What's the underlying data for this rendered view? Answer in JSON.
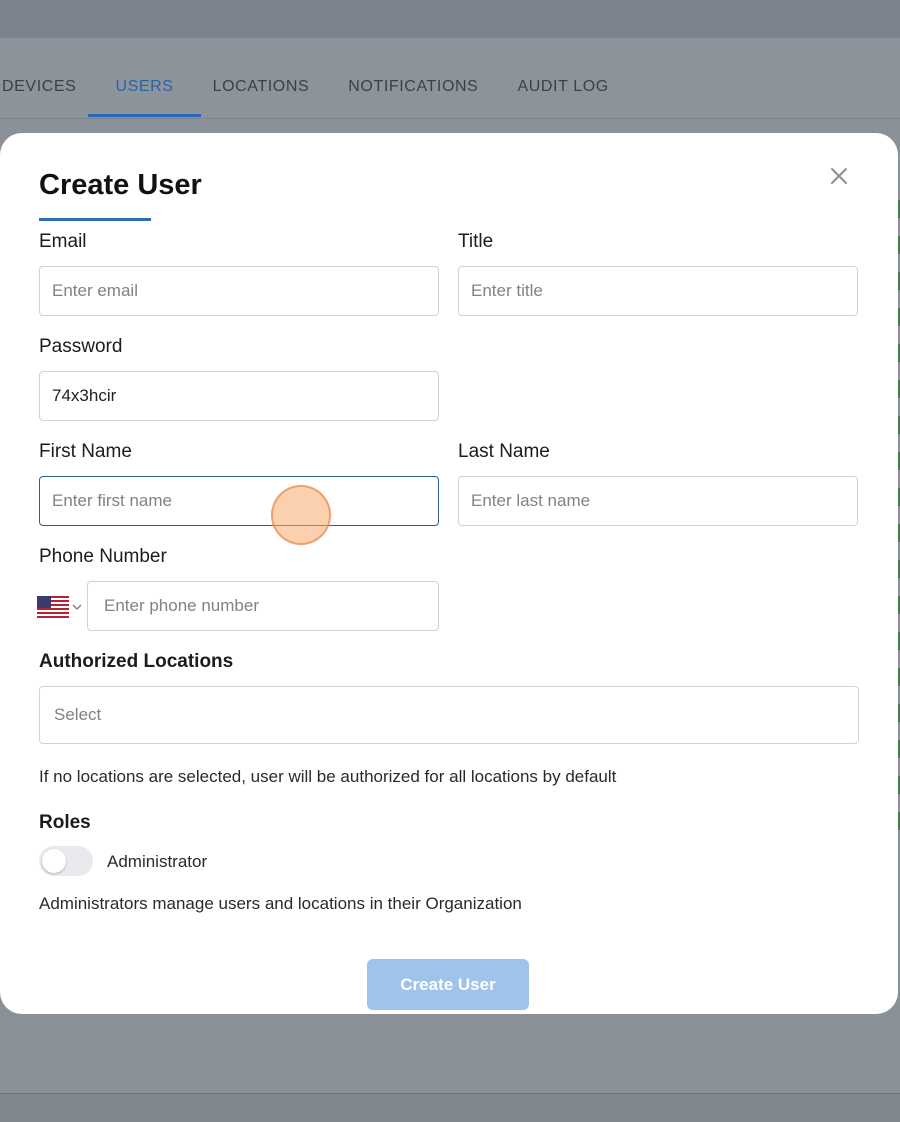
{
  "nav": {
    "tabs": [
      {
        "label": "DEVICES"
      },
      {
        "label": "USERS",
        "active": true
      },
      {
        "label": "LOCATIONS"
      },
      {
        "label": "NOTIFICATIONS"
      },
      {
        "label": "AUDIT LOG"
      }
    ]
  },
  "modal": {
    "title": "Create User",
    "close_icon": "close-icon",
    "email": {
      "label": "Email",
      "placeholder": "Enter email",
      "value": ""
    },
    "title_field": {
      "label": "Title",
      "placeholder": "Enter title",
      "value": ""
    },
    "password": {
      "label": "Password",
      "value": "74x3hcir"
    },
    "first_name": {
      "label": "First Name",
      "placeholder": "Enter first name",
      "value": ""
    },
    "last_name": {
      "label": "Last Name",
      "placeholder": "Enter last name",
      "value": ""
    },
    "phone": {
      "label": "Phone Number",
      "placeholder": "Enter phone number",
      "country_icon": "us-flag-icon"
    },
    "locations": {
      "label": "Authorized Locations",
      "placeholder": "Select",
      "hint": "If no locations are selected, user will be authorized for all locations by default"
    },
    "roles": {
      "label": "Roles",
      "administrator_label": "Administrator",
      "administrator_on": false,
      "hint": "Administrators manage users and locations in their Organization"
    },
    "submit_label": "Create User"
  },
  "colors": {
    "accent": "#2c6fb3",
    "submit_disabled": "#9fc3ea",
    "overlay": "#8a9199"
  }
}
